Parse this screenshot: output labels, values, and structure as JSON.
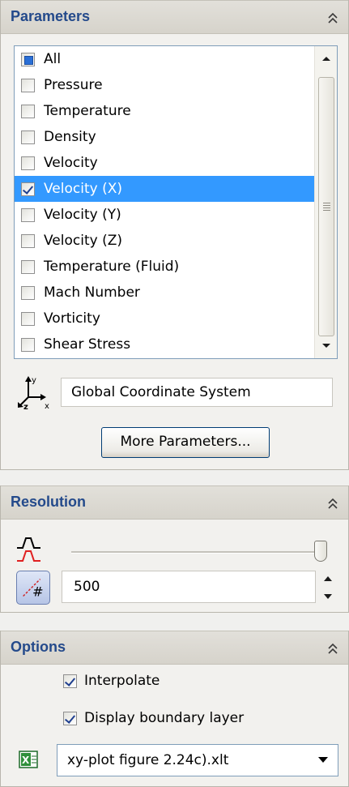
{
  "parameters": {
    "title": "Parameters",
    "items": [
      {
        "label": "All",
        "state": "partial",
        "selected": false
      },
      {
        "label": "Pressure",
        "state": "unchecked",
        "selected": false
      },
      {
        "label": "Temperature",
        "state": "unchecked",
        "selected": false
      },
      {
        "label": "Density",
        "state": "unchecked",
        "selected": false
      },
      {
        "label": "Velocity",
        "state": "unchecked",
        "selected": false
      },
      {
        "label": "Velocity (X)",
        "state": "checked",
        "selected": true
      },
      {
        "label": "Velocity (Y)",
        "state": "unchecked",
        "selected": false
      },
      {
        "label": "Velocity (Z)",
        "state": "unchecked",
        "selected": false
      },
      {
        "label": "Temperature (Fluid)",
        "state": "unchecked",
        "selected": false
      },
      {
        "label": "Mach Number",
        "state": "unchecked",
        "selected": false
      },
      {
        "label": "Vorticity",
        "state": "unchecked",
        "selected": false
      },
      {
        "label": "Shear Stress",
        "state": "unchecked",
        "selected": false
      }
    ],
    "coordinate_system": "Global Coordinate System",
    "more_button": "More Parameters...",
    "coord_icon_axes": {
      "y": "y",
      "z": "z",
      "x": "x"
    }
  },
  "resolution": {
    "title": "Resolution",
    "slider_level": 1.0,
    "points_value": "500",
    "points_icon_glyph": "#"
  },
  "options": {
    "title": "Options",
    "interpolate_label": "Interpolate",
    "interpolate_checked": true,
    "boundary_label": "Display boundary layer",
    "boundary_checked": true,
    "template_value": "xy-plot figure 2.24c).xlt",
    "template_icon_glyph": "X"
  },
  "colors": {
    "header_text": "#244a8b",
    "selection": "#3399ff",
    "collapse_chevron": "#3a3a3a"
  },
  "icons": {
    "collapse": "double-chevron-up-icon",
    "coordinate": "coordinate-axes-icon",
    "resolution": "resolution-wave-icon",
    "points": "point-count-icon",
    "excel": "excel-template-icon"
  }
}
